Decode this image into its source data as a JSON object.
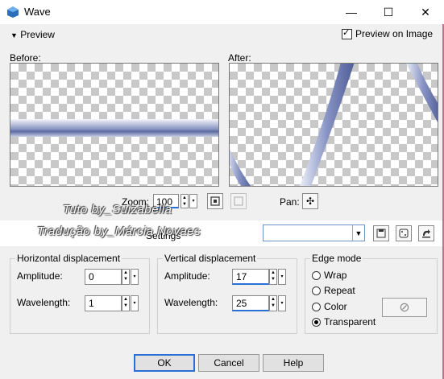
{
  "window": {
    "title": "Wave",
    "minimize": "—",
    "maximize": "☐",
    "close": "✕"
  },
  "preview": {
    "toggle_label": "Preview",
    "toggle_icon": "▼",
    "show_on_image_label": "Preview on Image",
    "show_on_image_checked": true
  },
  "panes": {
    "before_label": "Before:",
    "after_label": "After:"
  },
  "zoom": {
    "label": "Zoom:",
    "value": "100"
  },
  "pan": {
    "label": "Pan:",
    "icon": "✣"
  },
  "watermark": {
    "line1": "Tuto by_Suizabella",
    "line2": "Tradução by_Márcia Novaes"
  },
  "settings": {
    "label": "Settings",
    "value": ""
  },
  "horizontal": {
    "title": "Horizontal displacement",
    "amplitude_label": "Amplitude:",
    "amplitude": "0",
    "wavelength_label": "Wavelength:",
    "wavelength": "1"
  },
  "vertical": {
    "title": "Vertical displacement",
    "amplitude_label": "Amplitude:",
    "amplitude": "17",
    "wavelength_label": "Wavelength:",
    "wavelength": "25"
  },
  "edge_mode": {
    "title": "Edge mode",
    "options": [
      "Wrap",
      "Repeat",
      "Color",
      "Transparent"
    ],
    "selected": "Transparent"
  },
  "buttons": {
    "ok": "OK",
    "cancel": "Cancel",
    "help": "Help"
  }
}
